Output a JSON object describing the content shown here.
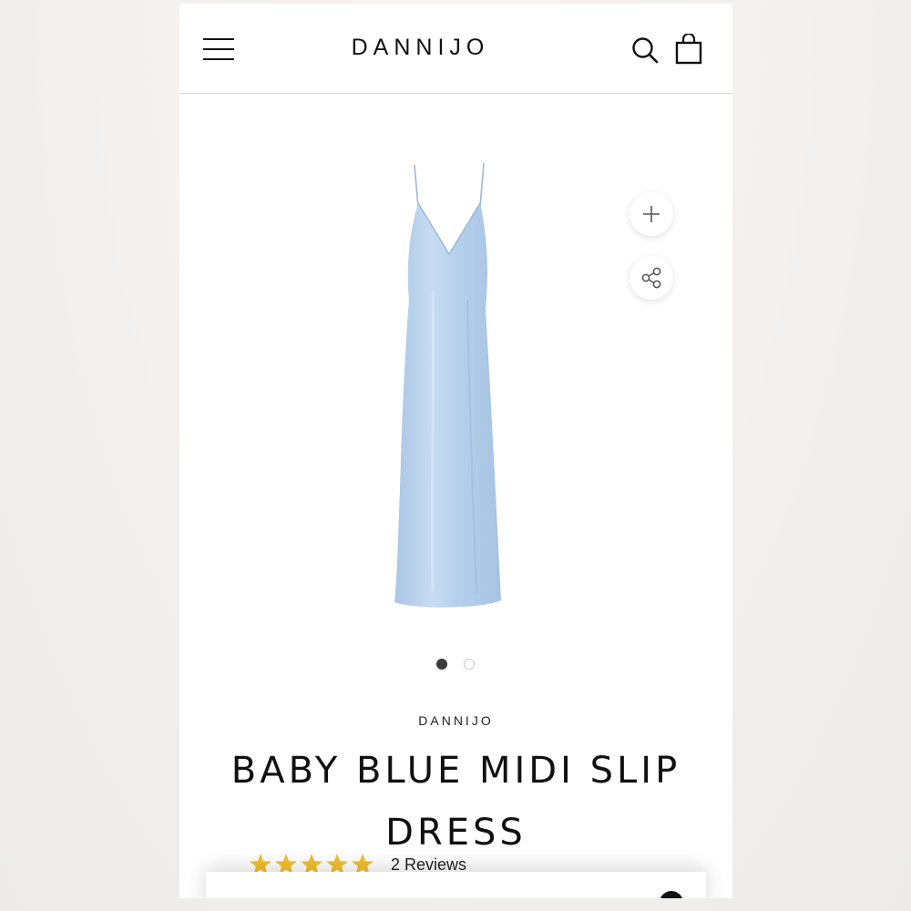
{
  "header": {
    "brand": "DANNIJO",
    "menu_icon": "hamburger-menu-icon",
    "search_icon": "search-icon",
    "bag_icon": "shopping-bag-icon"
  },
  "gallery": {
    "image_alt": "baby blue satin midi slip dress",
    "zoom_icon": "plus-icon",
    "share_icon": "share-icon",
    "slide_count": 2,
    "active_slide": 1,
    "dress_color": "#b9d4ee"
  },
  "product": {
    "vendor": "DANNIJO",
    "title": "BABY BLUE MIDI SLIP DRESS",
    "rating": 5,
    "max_rating": 5,
    "reviews_label": "2 Reviews",
    "star_color": "#f2c12e"
  }
}
